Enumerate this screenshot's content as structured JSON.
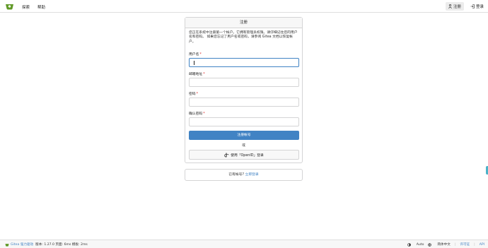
{
  "nav": {
    "explore": "探索",
    "help": "帮助",
    "register": "注册",
    "signin": "登录"
  },
  "register_card": {
    "title": "注册",
    "info": "您正在系统中注册第一个帐户。它拥有管理员权限。请仔细记住您的用户名和密码。 如果您忘记了用户名或密码，请参阅 Gitea 文档以恢复帐户。",
    "username_label": "用户名",
    "email_label": "邮箱地址",
    "password_label": "密码",
    "confirm_password_label": "确认密码",
    "username_value": "",
    "email_value": "",
    "password_value": "",
    "confirm_password_value": "",
    "submit": "注册帐号",
    "or": "或",
    "openid": "使用「OpenID」登录"
  },
  "signin_card": {
    "question": "已有帐号?",
    "link": "立即登录"
  },
  "footer": {
    "powered": "Gitea 强力驱动",
    "version": "版本: 1.27.0 页面: 6ms 模板: 2ms",
    "theme": "Auto",
    "language": "简体中文",
    "license": "许可证",
    "api": "API"
  },
  "colors": {
    "primary": "#4183c4",
    "logo_green": "#609926",
    "required": "#db2828"
  }
}
